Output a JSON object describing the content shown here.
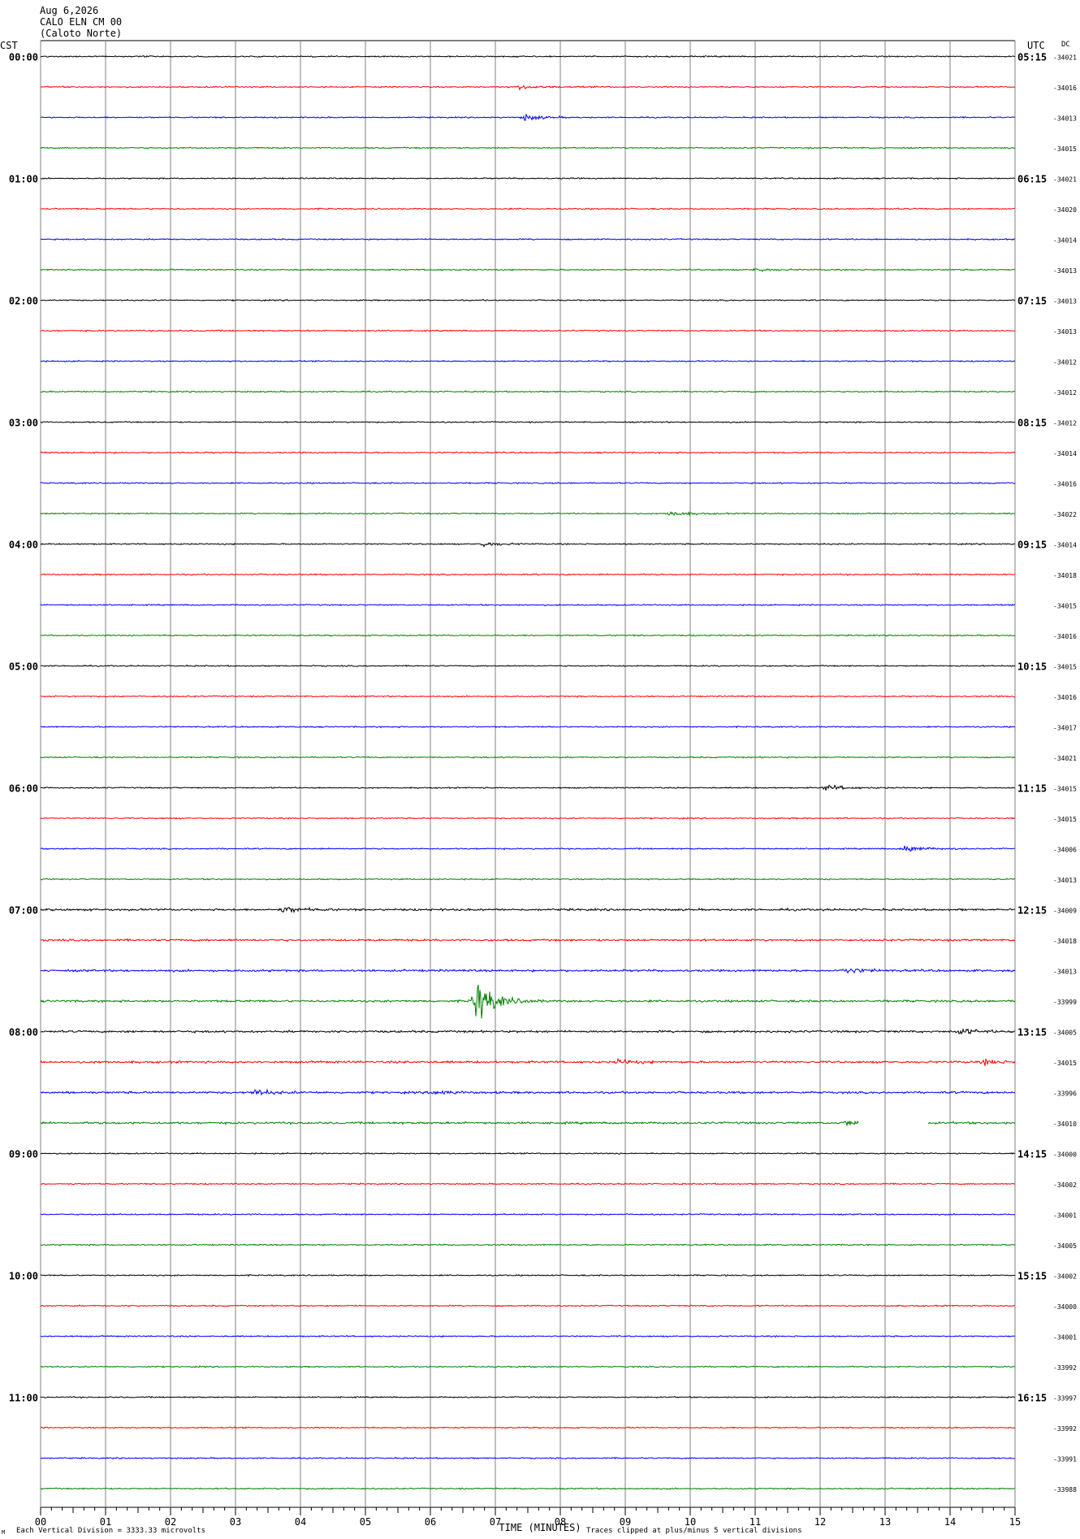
{
  "header": {
    "date": "Aug 6,2026",
    "station": "CALO ELN CM 00",
    "site": "(Caloto Norte)",
    "left_tz": "CST",
    "right_tz": "UTC",
    "dc_label": "DC"
  },
  "footer": {
    "xlabel": "TIME (MINUTES)",
    "scale_note": "Each Vertical Division = 3333.33 microvolts",
    "clip_note": "Traces clipped at plus/minus 5 vertical divisions",
    "logo_mark": "M"
  },
  "colors": {
    "trace_cycle": [
      "#000000",
      "#ff0000",
      "#0000ff",
      "#008000"
    ],
    "grid": "#808080"
  },
  "chart_data": {
    "type": "line",
    "x_ticks": [
      "00",
      "01",
      "02",
      "03",
      "04",
      "05",
      "06",
      "07",
      "08",
      "09",
      "10",
      "11",
      "12",
      "13",
      "14",
      "15"
    ],
    "xlim": [
      0,
      15
    ],
    "hour_labels_left": [
      "00:00",
      "01:00",
      "02:00",
      "03:00",
      "04:00",
      "05:00",
      "06:00",
      "07:00",
      "08:00",
      "09:00",
      "10:00",
      "11:00"
    ],
    "hour_labels_right": [
      "05:15",
      "06:15",
      "07:15",
      "08:15",
      "09:15",
      "10:15",
      "11:15",
      "12:15",
      "13:15",
      "14:15",
      "15:15",
      "16:15"
    ],
    "dc_offsets": [
      "-34021",
      "-34016",
      "-34013",
      "-34015",
      "-34021",
      "-34020",
      "-34014",
      "-34013",
      "-34013",
      "-34013",
      "-34012",
      "-34012",
      "-34012",
      "-34014",
      "-34016",
      "-34022",
      "-34014",
      "-34018",
      "-34015",
      "-34016",
      "-34015",
      "-34016",
      "-34017",
      "-34021",
      "-34015",
      "-34015",
      "-34006",
      "-34013",
      "-34009",
      "-34018",
      "-34013",
      "-33999",
      "-34005",
      "-34015",
      "-33996",
      "-34010",
      "-34000",
      "-34002",
      "-34001",
      "-34005",
      "-34002",
      "-34000",
      "-34001",
      "-33992",
      "-33997",
      "-33992",
      "-33991",
      "-33988"
    ],
    "events": [
      {
        "row": 1,
        "minute": 7.4,
        "amp": 4
      },
      {
        "row": 2,
        "minute": 7.45,
        "amp": 5
      },
      {
        "row": 7,
        "minute": 11.0,
        "amp": 3
      },
      {
        "row": 15,
        "minute": 9.7,
        "amp": 4
      },
      {
        "row": 16,
        "minute": 6.8,
        "amp": 4
      },
      {
        "row": 24,
        "minute": 12.1,
        "amp": 5
      },
      {
        "row": 26,
        "minute": 13.3,
        "amp": 6
      },
      {
        "row": 28,
        "minute": 3.75,
        "amp": 5
      },
      {
        "row": 30,
        "minute": 12.4,
        "amp": 5
      },
      {
        "row": 31,
        "minute": 6.7,
        "amp": 38
      },
      {
        "row": 32,
        "minute": 14.15,
        "amp": 5
      },
      {
        "row": 33,
        "minute": 8.9,
        "amp": 4
      },
      {
        "row": 33,
        "minute": 14.55,
        "amp": 4
      },
      {
        "row": 34,
        "minute": 3.3,
        "amp": 5
      },
      {
        "row": 34,
        "minute": 6.05,
        "amp": 4
      },
      {
        "row": 35,
        "minute": 12.4,
        "amp": 4
      }
    ],
    "gaps": [
      {
        "row": 35,
        "from": 12.6,
        "to": 13.65
      }
    ]
  }
}
